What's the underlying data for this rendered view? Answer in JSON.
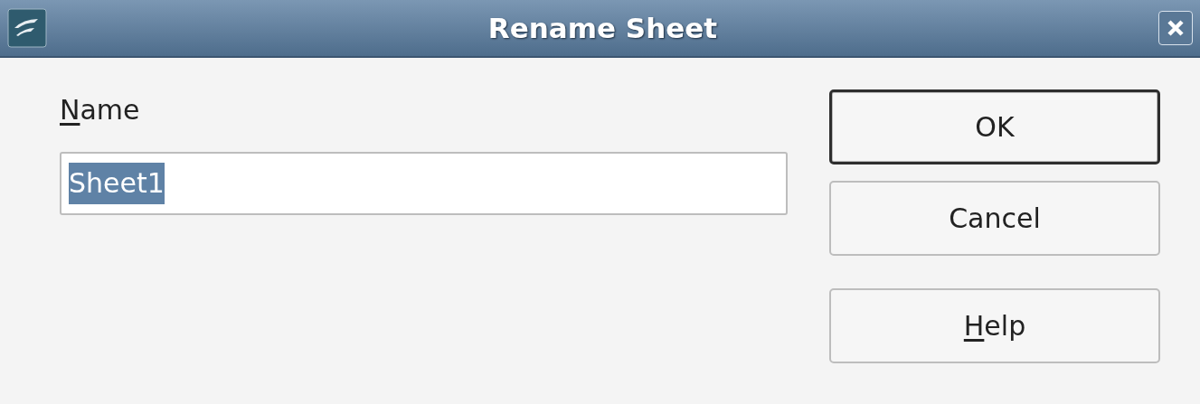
{
  "window": {
    "title": "Rename Sheet"
  },
  "name_field": {
    "label": "Name",
    "label_mnemonic": true,
    "value": "Sheet1",
    "selected": true
  },
  "buttons": [
    {
      "label": "OK",
      "default": true,
      "mnemonic": false
    },
    {
      "label": "Cancel",
      "default": false,
      "mnemonic": false
    },
    {
      "label": "Help",
      "default": false,
      "mnemonic": true
    }
  ]
}
